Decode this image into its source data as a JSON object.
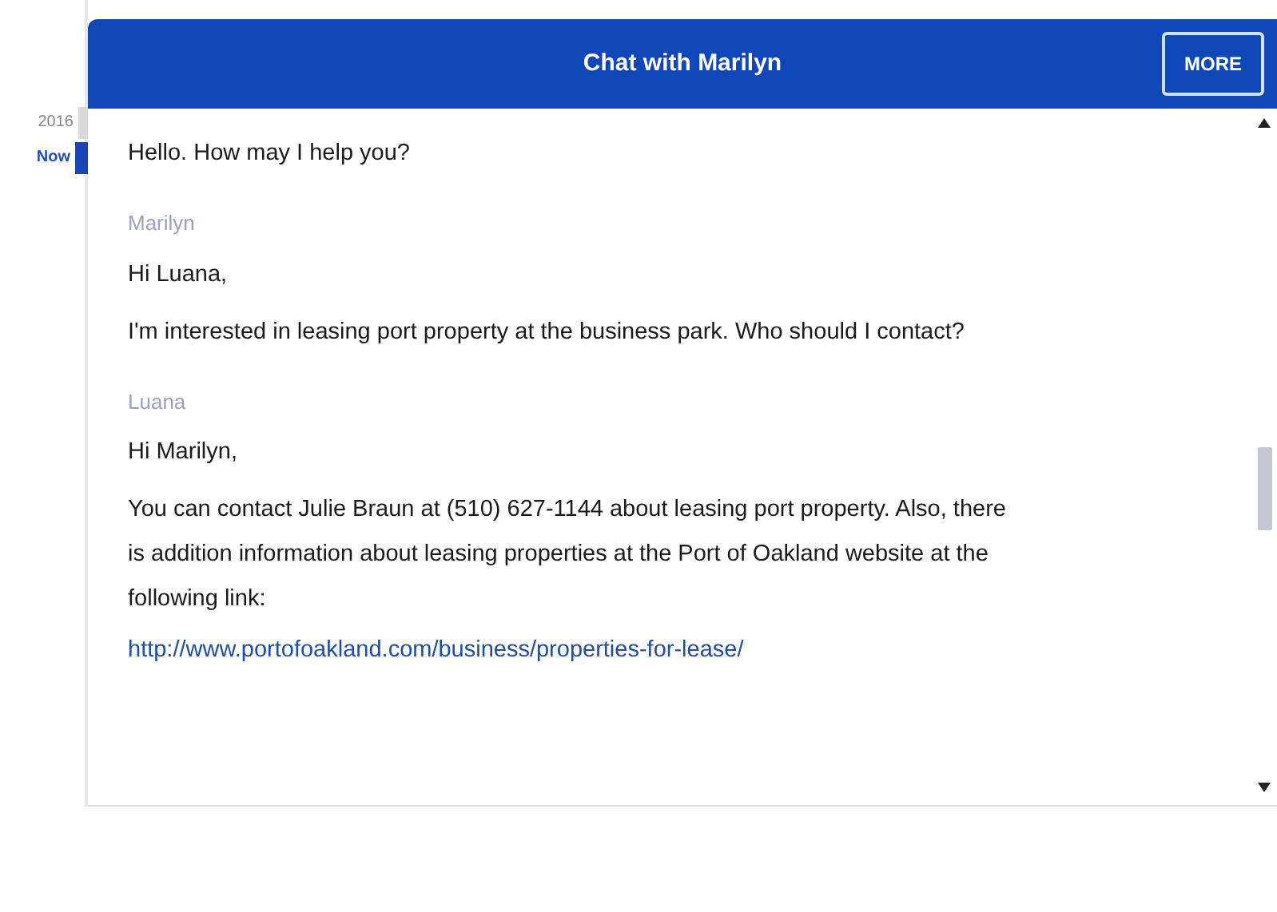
{
  "timeline": [
    {
      "label": "2016",
      "selected": false
    },
    {
      "label": "Now",
      "selected": true
    }
  ],
  "chat": {
    "title": "Chat with Marilyn",
    "more_button": "MORE",
    "messages": [
      {
        "paragraphs": [
          "Hello. How may I help you?"
        ]
      },
      {
        "sender": "Marilyn",
        "paragraphs": [
          "Hi Luana,",
          "I'm interested in leasing port property at the business park. Who should I contact?"
        ]
      },
      {
        "sender": "Luana",
        "paragraphs": [
          "Hi Marilyn,",
          "You can contact Julie Braun at (510) 627-1144 about leasing port property. Also, there is addition information about leasing properties at the Port of Oakland website at the following link:"
        ],
        "link": "http://www.portofoakland.com/business/properties-for-lease/"
      }
    ]
  }
}
